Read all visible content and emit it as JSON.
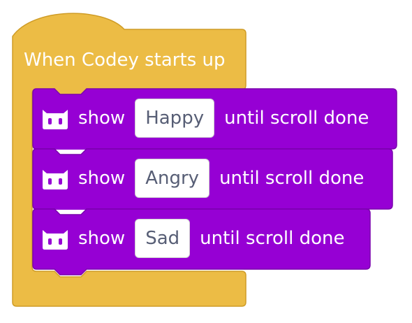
{
  "colors": {
    "hat_fill": "#ecbc45",
    "hat_stroke": "#cf9c26",
    "block_fill": "#9600d4",
    "block_stroke": "#7a00ad",
    "field_text": "#575e75"
  },
  "hat": {
    "label": "When Codey starts up"
  },
  "blocks": [
    {
      "icon": "codey-robot-icon",
      "verb": "show",
      "field_value": "Happy",
      "suffix": "until scroll done"
    },
    {
      "icon": "codey-robot-icon",
      "verb": "show",
      "field_value": "Angry",
      "suffix": "until scroll done"
    },
    {
      "icon": "codey-robot-icon",
      "verb": "show",
      "field_value": "Sad",
      "suffix": "until scroll done"
    }
  ]
}
